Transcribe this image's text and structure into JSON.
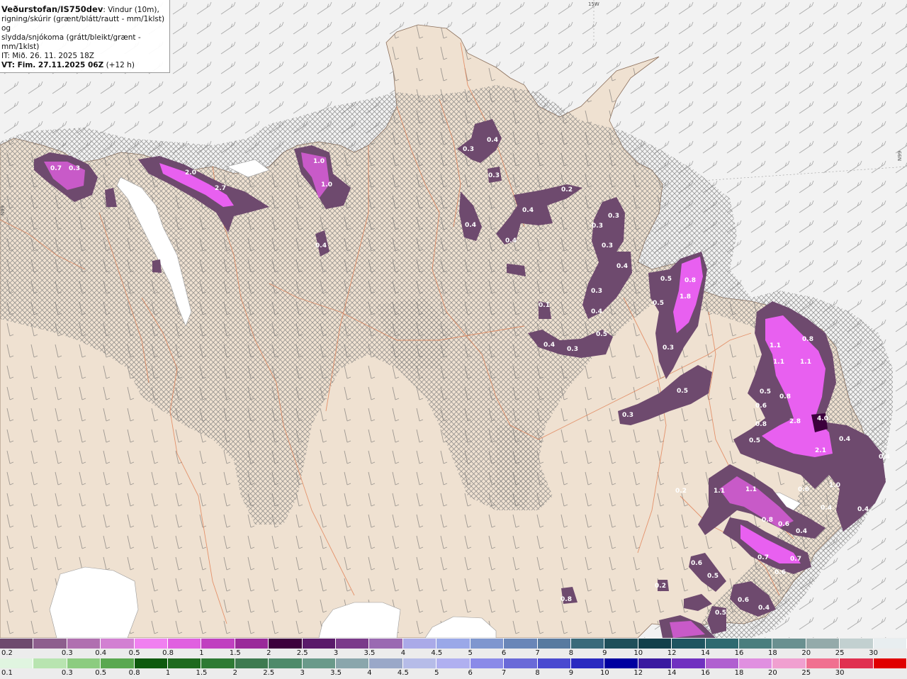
{
  "header": {
    "org": "Veðurstofan/IS750dev",
    "line1_rest": ": Vindur (10m),",
    "line2": "rigning/skúrir (grænt/blátt/rautt - mm/1klst) og",
    "line3": "slydda/snjókoma (grátt/bleikt/grænt - mm/1klst)",
    "it": "IT: Mið. 26. 11. 2025 18Z",
    "vt": "VT: Fim. 27.11.2025 06Z",
    "vt_offset": " (+12 h)"
  },
  "grid_labels": {
    "top": "15W",
    "left": "N99",
    "right": "N99"
  },
  "precip_labels": [
    "0.7",
    "0.3",
    "2.0",
    "2.7",
    "1.0",
    "1.0",
    "0.4",
    "0.3",
    "0.4",
    "0.3",
    "0.2",
    "0.4",
    "0.4",
    "0.4",
    "0.3",
    "0.3",
    "0.3",
    "0.4",
    "0.3",
    "0.4",
    "0.5",
    "0.8",
    "0.5",
    "1.8",
    "0.4",
    "0.3",
    "0.5",
    "0.3",
    "0.5",
    "0.3",
    "1.1",
    "0.8",
    "1.1",
    "1.1",
    "0.5",
    "0.6",
    "0.8",
    "0.8",
    "2.8",
    "4.0",
    "0.5",
    "2.1",
    "0.4",
    "0.4",
    "0.6",
    "1.0",
    "0.4",
    "0.4",
    "1.1",
    "1.1",
    "0.8",
    "0.6",
    "0.4",
    "0.7",
    "0.7",
    "0.6",
    "0.6",
    "0.5",
    "0.6",
    "0.4",
    "0.2",
    "0.8",
    "0.5",
    "0.1",
    "0.2"
  ],
  "legend_snow": {
    "colors": [
      "#6e4a6e",
      "#8e5f8e",
      "#b070b0",
      "#d280d2",
      "#f080f0",
      "#e060e0",
      "#c040c0",
      "#9a2a9a",
      "#3c003c",
      "#5a1a6a",
      "#7a3a8a",
      "#9a6ab2",
      "#aaaae8",
      "#9aa8e8",
      "#7f96cf",
      "#6a86b8",
      "#587aa0",
      "#3a6a7a",
      "#1f4f5a",
      "#123f4a",
      "#1e5560",
      "#2e6a70",
      "#4a7e7e",
      "#6a9090",
      "#94aaaa",
      "#c2d0d0",
      "#e8eef0"
    ],
    "labels": [
      "0.2",
      "0.3",
      "0.4",
      "0.5",
      "0.8",
      "1",
      "1.5",
      "2",
      "2.5",
      "3",
      "3.5",
      "4",
      "4.5",
      "5",
      "6",
      "7",
      "8",
      "9",
      "10",
      "12",
      "14",
      "16",
      "18",
      "20",
      "25",
      "30"
    ]
  },
  "legend_rain": {
    "colors": [
      "#e0f5e0",
      "#b8e4b0",
      "#8ccc80",
      "#5aa850",
      "#0f5a0f",
      "#1e6a1e",
      "#2e7a34",
      "#3e7a50",
      "#4e8a6a",
      "#6a9a8a",
      "#8aa6ac",
      "#9aa8c8",
      "#b6bce8",
      "#b0b0f0",
      "#8a8ae8",
      "#6a6ad8",
      "#4a4ad0",
      "#2a2ac0",
      "#0000a0",
      "#3a1aa0",
      "#7030c0",
      "#b060d0",
      "#e090e0",
      "#f0a0d0",
      "#f07090",
      "#e03050",
      "#e00000"
    ],
    "labels": [
      "0.1",
      "0.3",
      "0.5",
      "0.8",
      "1",
      "1.5",
      "2",
      "2.5",
      "3",
      "3.5",
      "4",
      "4.5",
      "5",
      "6",
      "7",
      "8",
      "9",
      "10",
      "12",
      "14",
      "16",
      "18",
      "20",
      "25",
      "30"
    ]
  },
  "colors": {
    "land": "#efe1d1",
    "sea": "#f2f2f2",
    "ice": "#ffffff",
    "roads": "#e0784a",
    "snow_dark": "#6e4a6e",
    "snow_mid": "#b070b0",
    "snow_light": "#e860f0"
  }
}
